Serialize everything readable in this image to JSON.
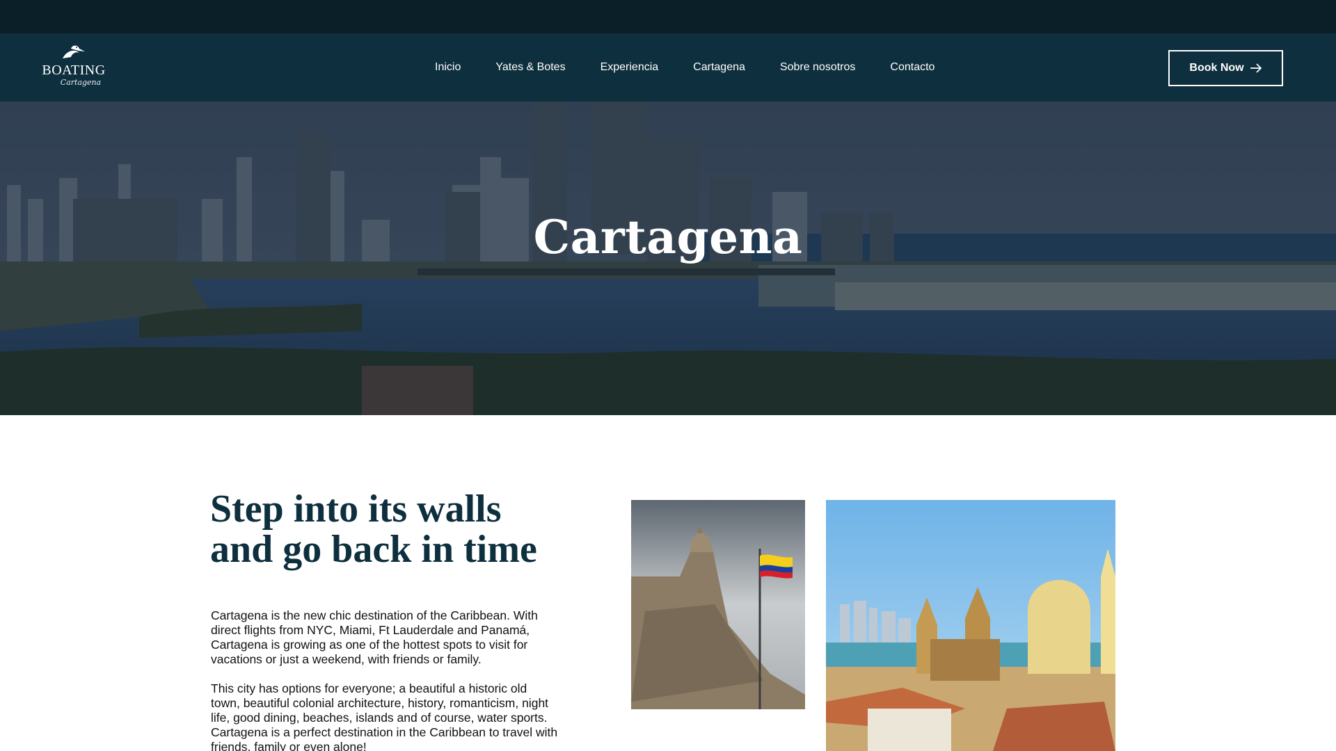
{
  "nav": {
    "logo_text": "BOATING",
    "logo_sub": "Cartagena",
    "menu": [
      {
        "label": "Inicio"
      },
      {
        "label": "Yates & Botes"
      },
      {
        "label": "Experiencia"
      },
      {
        "label": "Cartagena"
      },
      {
        "label": "Sobre nosotros"
      },
      {
        "label": "Contacto"
      }
    ],
    "cta_label": "Book Now",
    "cta_icon": "arrow-right-icon"
  },
  "hero": {
    "title": "Cartagena"
  },
  "content": {
    "heading": "Step into its walls and go back in time",
    "paragraphs": [
      "Cartagena is the new chic destination of the Caribbean. With direct flights from NYC, Miami, Ft Lauderdale and Panamá, Cartagena is growing as one of the hottest spots to visit for vacations or just a weekend, with friends or family.",
      "This city has options for everyone; a beautiful a historic old town, beautiful colonial architecture, history, romanticism, night life, good dining, beaches, islands and of course, water sports. Cartagena is a perfect destination in the Caribbean to travel with friends, family or even alone!"
    ]
  },
  "colors": {
    "topbar": "#0b1f29",
    "nav_bg": "#0e2f3e",
    "heading": "#0e2f3e",
    "text": "#111111"
  }
}
